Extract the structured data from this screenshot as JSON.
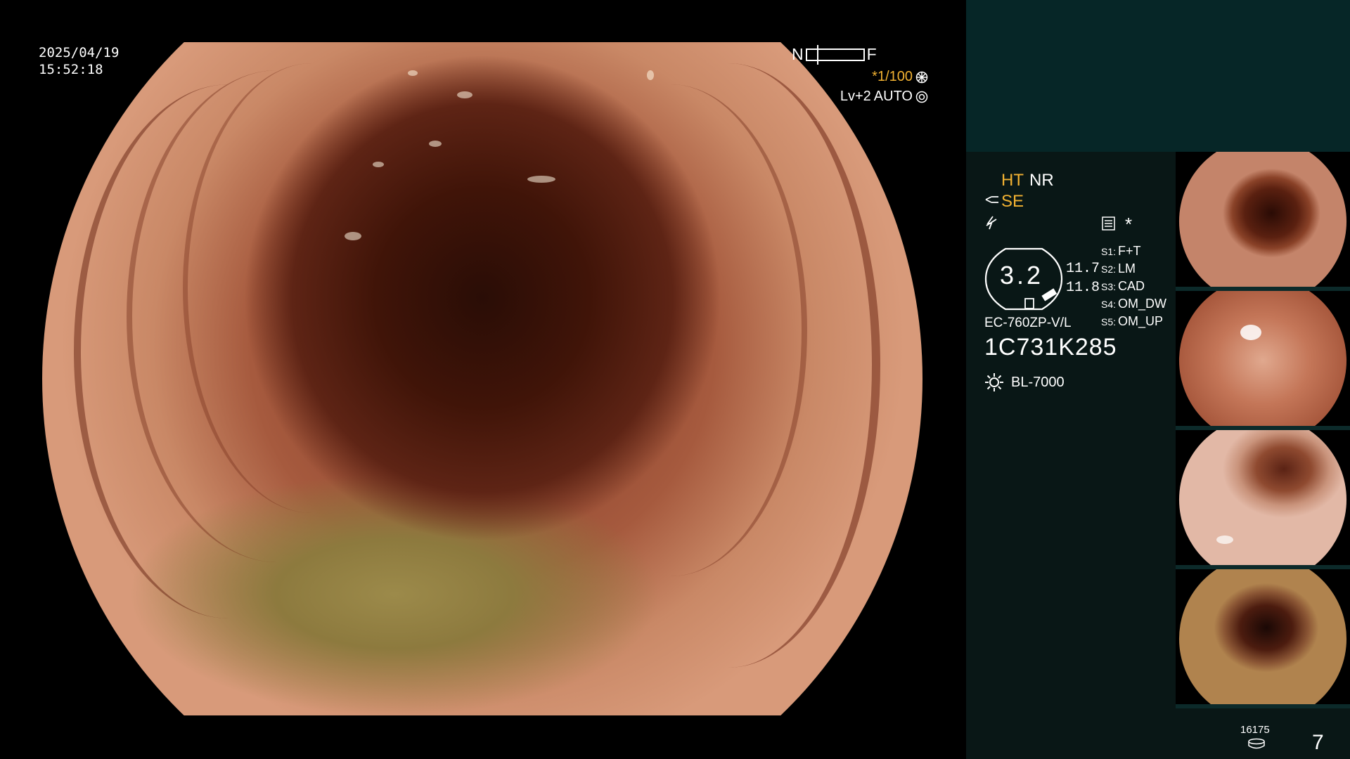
{
  "overlay": {
    "date": "2025/04/19",
    "time": "15:52:18",
    "near_label": "N",
    "far_label": "F",
    "shutter": "*1/100",
    "level": "Lv+2",
    "iris": "AUTO"
  },
  "panel": {
    "ht": "HT",
    "nr": "NR",
    "se": "SE",
    "asterisk": "*",
    "gauge_value": "3.2",
    "gauge_num1": "11.7",
    "gauge_num2": "11.8",
    "switches": [
      {
        "key": "S1:",
        "value": "F+T"
      },
      {
        "key": "S2:",
        "value": "LM"
      },
      {
        "key": "S3:",
        "value": "CAD"
      },
      {
        "key": "S4:",
        "value": "OM_DW"
      },
      {
        "key": "S5:",
        "value": "OM_UP"
      }
    ],
    "model": "EC-760ZP-V/L",
    "serial": "1C731K285",
    "light_source": "BL-7000"
  },
  "footer": {
    "storage_count": "16175",
    "page_count": "7"
  },
  "colors": {
    "accent_amber": "#f2b232",
    "panel_bg": "#091716",
    "panel_top_bg": "#062627"
  }
}
